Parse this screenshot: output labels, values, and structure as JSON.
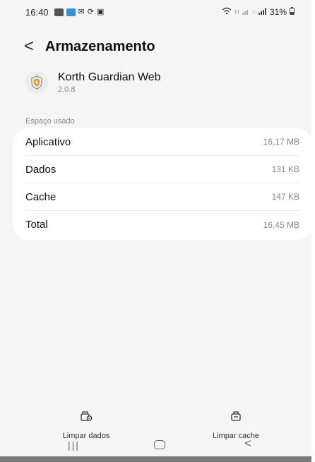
{
  "status_bar": {
    "time": "16:40",
    "battery": "31%"
  },
  "header": {
    "back_icon": "chevron-left-icon",
    "title": "Armazenamento"
  },
  "app": {
    "name": "Korth Guardian Web",
    "version": "2.0.8",
    "icon": "shield-app-icon"
  },
  "section": {
    "label": "Espaço usado"
  },
  "storage": {
    "rows": [
      {
        "label": "Aplicativo",
        "value": "16,17 MB"
      },
      {
        "label": "Dados",
        "value": "131 KB"
      },
      {
        "label": "Cache",
        "value": "147 KB"
      },
      {
        "label": "Total",
        "value": "16,45 MB"
      }
    ]
  },
  "actions": {
    "clear_data": "Limpar dados",
    "clear_cache": "Limpar cache"
  },
  "colors": {
    "background": "#f5f5f5",
    "card": "#ffffff",
    "shield_orange": "#e8a23a"
  }
}
